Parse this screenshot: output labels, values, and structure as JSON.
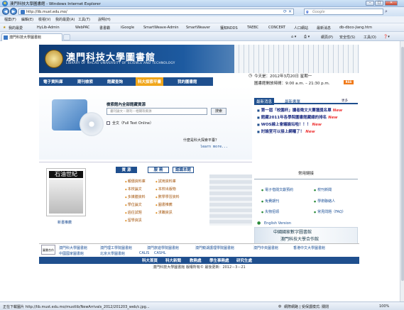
{
  "browser": {
    "title": "澳門科技大學圖書館 - Windows Internet Explorer",
    "url": "http://lib.must.edu.mo/",
    "search_placeholder": "Google",
    "menu": [
      "檔案(F)",
      "編輯(E)",
      "檢視(V)",
      "我的最愛(A)",
      "工具(T)",
      "說明(H)"
    ],
    "favorites_label": "我的最愛",
    "favorites": [
      "HyLib-Admin",
      "WebPAC",
      "書書霸",
      "iGoogle",
      "SmartWeave-Admin",
      "SmartWeaver",
      "獲知NDDS",
      "TAEBC",
      "CONCERT",
      "人口網站",
      "最新消息",
      "db-dbco-jiang.htm"
    ],
    "tab_label": "澳門科技大學圖書館",
    "commands": [
      "網頁(P)",
      "安全性(S)",
      "工具(O)"
    ],
    "status_left": "正在下載圖片 http://lib.must.edu.mo/mustlib/NewArrivals_2012/201203_web/c.jpg...",
    "status_zone": "網際網路 | 受保護模式: 關閉",
    "zoom": "100%"
  },
  "header": {
    "title_cn": "澳門科技大學圖書館",
    "title_en": "LIBRARY OF MACAU UNIVERSITY OF SCIENCE AND TECHNOLOGY"
  },
  "nav": [
    "電子資料庫",
    "期刊檢索",
    "館藏查詢",
    "科大探索平臺",
    "我的圖書館"
  ],
  "date_line": "今天是：2012年3月20日 星期一",
  "hours_line": "圖書館開放時間：9:00 a.m. – 21:30 p.m.",
  "rss": "RSS",
  "search": {
    "title": "檢索館內全部館藏資源",
    "placeholder": "書刊論文－期刊－相關等資源",
    "button": "搜索",
    "fulltext": "全文（Full Text Online）",
    "question": "什麼是科大探索平臺？",
    "more": "learn more..."
  },
  "news": {
    "tabs": [
      "最新消息",
      "最新書單"
    ],
    "more": "更多",
    "items": [
      "第一屆「校園杯」讀者徵文大賽獲獎名單",
      "館藏2011年各學院圖書館藏總的排名",
      "WOS線上會議論坛啦！！！",
      "討論室可以接上網囉了！"
    ],
    "new_tag": "New"
  },
  "resources": {
    "tabs": [
      "資 源",
      "服 務",
      "認識本館"
    ],
    "left": [
      "報價資料庫",
      "本校論文",
      "多媒體資料",
      "學位論文",
      "過往試題",
      "留學資訊"
    ],
    "right": [
      "試用資料庫",
      "本校出版物",
      "數學學習資料",
      "圖書推薦",
      "求職資訊"
    ]
  },
  "magazine": {
    "cover": "石油世紀",
    "label": "新書推薦"
  },
  "tools": {
    "title": "常用鏈接",
    "left": [
      "電子借閱文獻預約",
      "免費期刊",
      "失物招領"
    ],
    "right": [
      "校刊新聞",
      "學術聯絡人",
      "常見問題（FAQ）"
    ],
    "english": "English Version"
  },
  "footer_logo_cn1": "中國國家數字圖書館",
  "footer_logo_cn2": "澳門科技大學合作館",
  "links_logo": "圖書合作",
  "links": [
    "澳門科大學圖書館",
    "澳門理工學院圖書館",
    "澳門旅遊學院圖書館",
    "澳門鏡湖護理學院圖書館",
    "澳門中央圖書館",
    "香港中文大學圖書館",
    "中國國家圖書館",
    "北京大學圖書館",
    "CALIS",
    "CASHL"
  ],
  "bottom_nav": [
    "科大首頁",
    "科大新聞",
    "教務處",
    "學生事務處",
    "研究生處"
  ],
  "copyright": "澳門科技大學圖書館  版權所有© 最後更新：2012－3－21"
}
